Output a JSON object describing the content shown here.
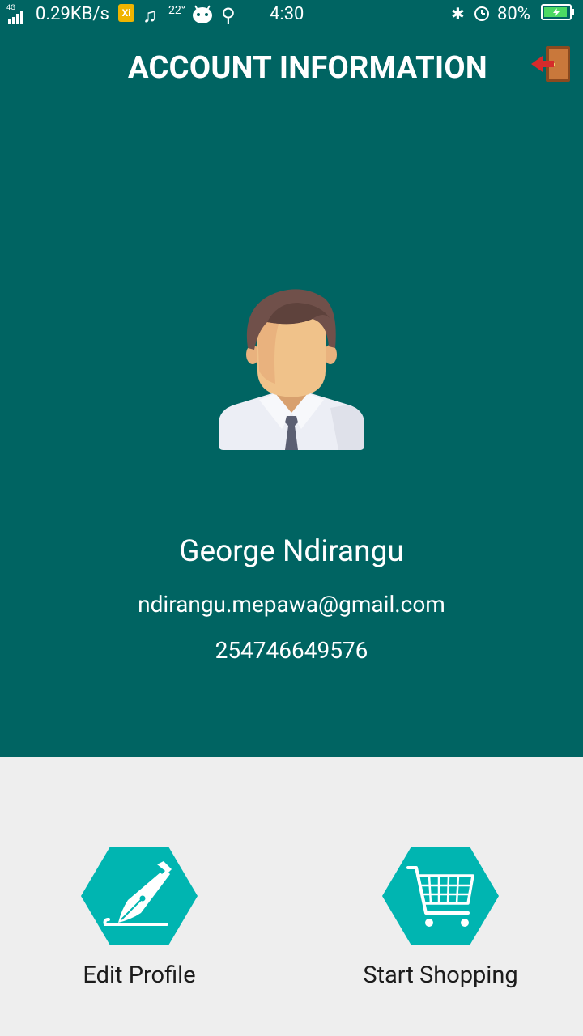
{
  "status_bar": {
    "network": "4G",
    "speed": "0.29KB/s",
    "xi_badge": "Xi",
    "temperature": "22°",
    "time": "4:30",
    "battery_percent": "80%",
    "icons": [
      "signal-icon",
      "music-note-icon",
      "android-icon",
      "usb-icon",
      "bluetooth-icon",
      "alarm-icon",
      "battery-icon"
    ]
  },
  "header": {
    "title": "ACCOUNT INFORMATION",
    "logout_icon": "exit-door-icon"
  },
  "profile": {
    "avatar_icon": "user-avatar-icon",
    "name": "George Ndirangu",
    "email": "ndirangu.mepawa@gmail.com",
    "phone": "254746649576"
  },
  "actions": [
    {
      "label": "Edit Profile",
      "icon": "pen-icon"
    },
    {
      "label": "Start Shopping",
      "icon": "shopping-cart-icon"
    }
  ],
  "colors": {
    "primary": "#006462",
    "accent": "#00b5b1",
    "background": "#eeeeee",
    "text_dark": "#1c1c1c"
  }
}
